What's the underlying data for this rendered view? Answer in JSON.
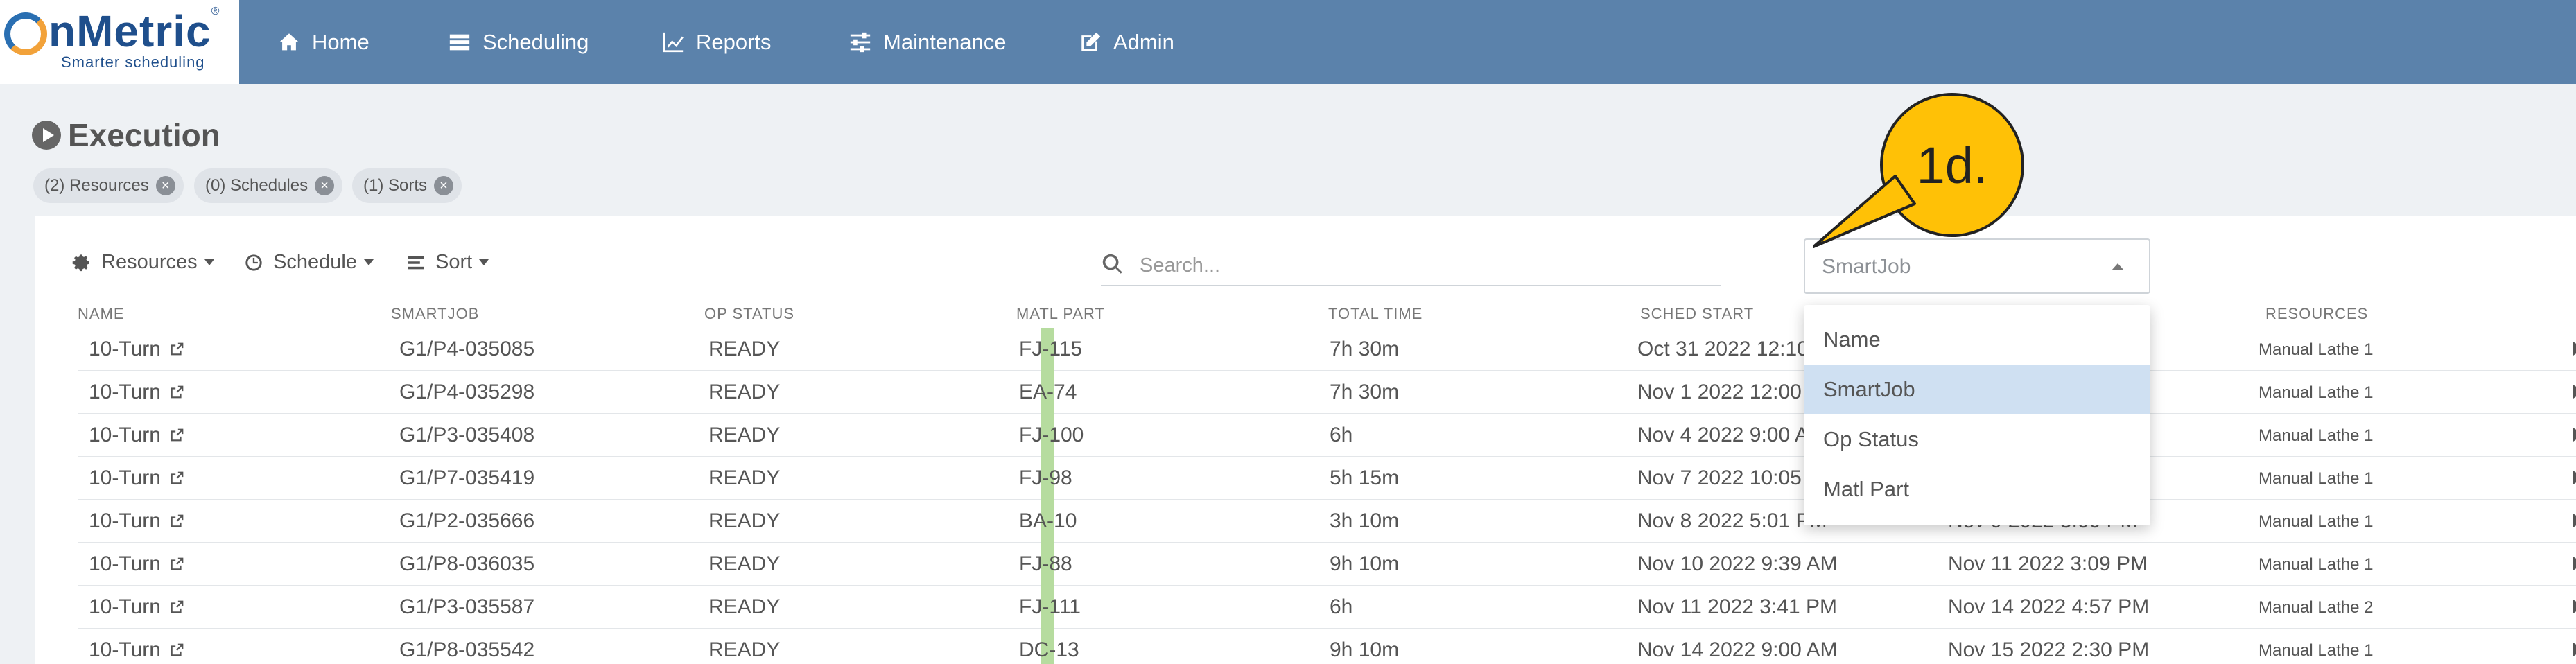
{
  "logo": {
    "brand": "nMetric",
    "registered": "®",
    "tagline": "Smarter scheduling"
  },
  "nav": {
    "home": "Home",
    "scheduling": "Scheduling",
    "reports": "Reports",
    "maintenance": "Maintenance",
    "admin": "Admin"
  },
  "page": {
    "title": "Execution"
  },
  "chips": [
    {
      "label": "(2) Resources"
    },
    {
      "label": "(0) Schedules"
    },
    {
      "label": "(1) Sorts"
    }
  ],
  "toolbar": {
    "resources": "Resources",
    "schedule": "Schedule",
    "sort": "Sort",
    "search_placeholder": "Search...",
    "search_by": "SmartJob"
  },
  "dropdown": {
    "options": [
      "Name",
      "SmartJob",
      "Op Status",
      "Matl Part"
    ],
    "selected": "SmartJob"
  },
  "callout": {
    "label": "1d.",
    "color": "#ffc106"
  },
  "table": {
    "columns": {
      "name": "NAME",
      "smartjob": "SMARTJOB",
      "op_status": "OP STATUS",
      "matl_part": "MATL PART",
      "total_time": "TOTAL TIME",
      "sched_start": "SCHED START",
      "resources": "RESOURCES"
    },
    "rows": [
      {
        "name": "10-Turn",
        "smartjob": "G1/P4-035085",
        "op_status": "READY",
        "matl_part": "FJ-115",
        "total_time": "7h 30m",
        "sched_start": "Oct 31 2022 12:10",
        "sched_end": "",
        "resources": "Manual Lathe 1"
      },
      {
        "name": "10-Turn",
        "smartjob": "G1/P4-035298",
        "op_status": "READY",
        "matl_part": "EA-74",
        "total_time": "7h 30m",
        "sched_start": "Nov 1 2022 12:00",
        "sched_end": "",
        "resources": "Manual Lathe 1"
      },
      {
        "name": "10-Turn",
        "smartjob": "G1/P3-035408",
        "op_status": "READY",
        "matl_part": "FJ-100",
        "total_time": "6h",
        "sched_start": "Nov 4 2022 9:00 A",
        "sched_end": "",
        "resources": "Manual Lathe 1"
      },
      {
        "name": "10-Turn",
        "smartjob": "G1/P7-035419",
        "op_status": "READY",
        "matl_part": "FJ-98",
        "total_time": "5h 15m",
        "sched_start": "Nov 7 2022 10:05",
        "sched_end": "",
        "resources": "Manual Lathe 1"
      },
      {
        "name": "10-Turn",
        "smartjob": "G1/P2-035666",
        "op_status": "READY",
        "matl_part": "BA-10",
        "total_time": "3h 10m",
        "sched_start": "Nov 8 2022 5:01 PM",
        "sched_end": "Nov 9 2022 3:00 PM",
        "resources": "Manual Lathe 1"
      },
      {
        "name": "10-Turn",
        "smartjob": "G1/P8-036035",
        "op_status": "READY",
        "matl_part": "FJ-88",
        "total_time": "9h 10m",
        "sched_start": "Nov 10 2022 9:39 AM",
        "sched_end": "Nov 11 2022 3:09 PM",
        "resources": "Manual Lathe 1"
      },
      {
        "name": "10-Turn",
        "smartjob": "G1/P3-035587",
        "op_status": "READY",
        "matl_part": "FJ-111",
        "total_time": "6h",
        "sched_start": "Nov 11 2022 3:41 PM",
        "sched_end": "Nov 14 2022 4:57 PM",
        "resources": "Manual Lathe 2"
      },
      {
        "name": "10-Turn",
        "smartjob": "G1/P8-035542",
        "op_status": "READY",
        "matl_part": "DC-13",
        "total_time": "9h 10m",
        "sched_start": "Nov 14 2022 9:00 AM",
        "sched_end": "Nov 15 2022 2:30 PM",
        "resources": "Manual Lathe 1"
      }
    ]
  },
  "colors": {
    "navbar": "#5b82ab",
    "status_ready": "#b6dc9f",
    "selected_option": "#cfe0f2"
  }
}
